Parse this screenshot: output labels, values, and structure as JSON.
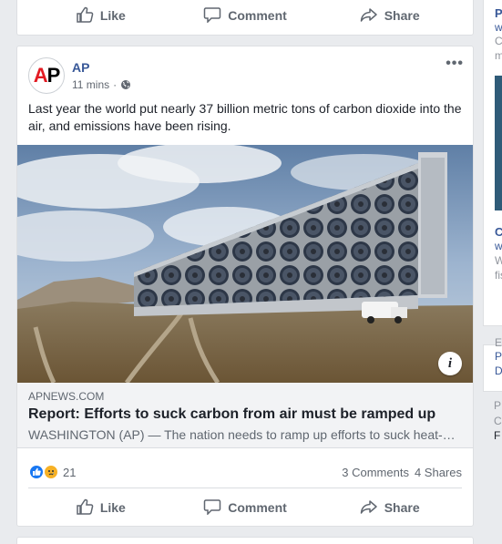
{
  "actions": {
    "like": "Like",
    "comment": "Comment",
    "share": "Share"
  },
  "post": {
    "page_name": "AP",
    "time": "11 mins",
    "dot": "·",
    "more": "•••",
    "text": "Last year the world put nearly 37 billion metric tons of carbon dioxide into the air, and emissions have been rising.",
    "avatar_text": "AP",
    "link": {
      "domain": "APNEWS.COM",
      "title": "Report: Efforts to suck carbon from air must be ramped up",
      "description": "WASHINGTON (AP) — The nation needs to ramp up efforts to suck heat-…",
      "info": "i"
    },
    "stats": {
      "reaction_count": "21",
      "comments": "3 Comments",
      "shares": "4 Shares"
    }
  },
  "sidebar": {
    "a1": "P",
    "a2": "w",
    "a3": "C",
    "a4": "m",
    "b1": "C",
    "b2": "w",
    "b3": "W",
    "b4": "fis",
    "c1": "E",
    "c2": "P",
    "c3": "D",
    "d1": "P",
    "d2": "C",
    "d3": "F"
  },
  "colors": {
    "link_blue": "#385898",
    "like_blue": "#1877f2",
    "sad_yellow": "#f7b125"
  }
}
